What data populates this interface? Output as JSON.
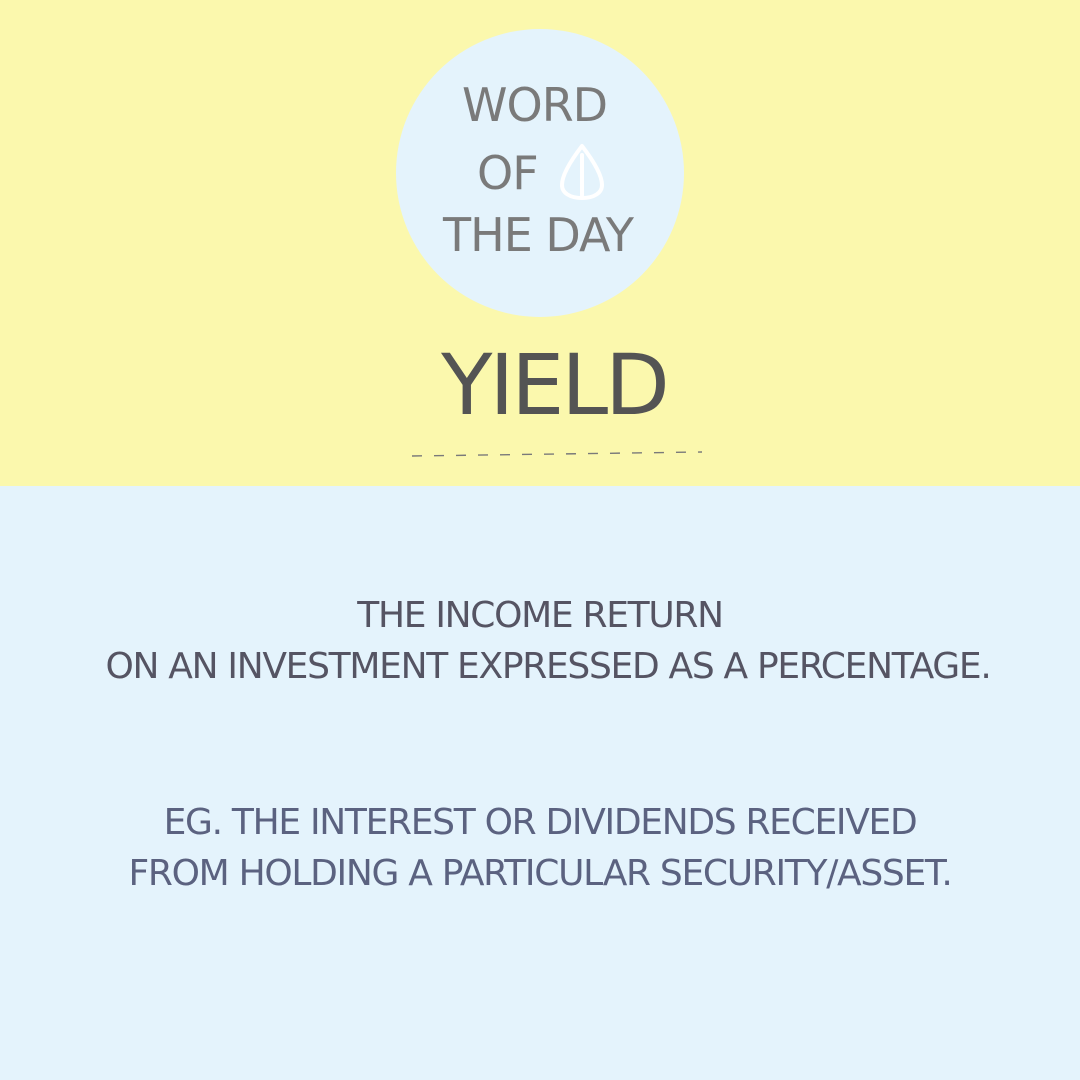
{
  "badge": {
    "line1": "WORD",
    "line2": "OF",
    "line3": "THE DAY",
    "icon": "leaf-drop-icon"
  },
  "term": "YIELD",
  "definition": {
    "line1": "THE INCOME RETURN",
    "line2": "ON AN INVESTMENT EXPRESSED AS A PERCENTAGE."
  },
  "example": {
    "line1": "EG. THE INTEREST OR DIVIDENDS RECEIVED",
    "line2": "FROM HOLDING A PARTICULAR SECURITY/ASSET."
  },
  "colors": {
    "top_background": "#fbf8ad",
    "bottom_background": "#e4f3fc",
    "badge_circle": "#e4f3fc",
    "badge_text": "#7a7a7a",
    "term_text": "#545454",
    "definition_text": "#555463",
    "example_text": "#5b6280"
  }
}
